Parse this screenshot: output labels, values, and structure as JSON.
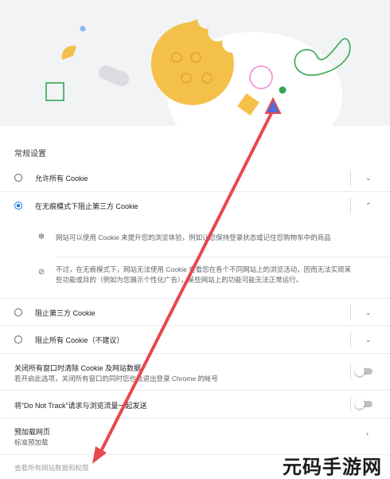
{
  "section_title": "常规设置",
  "options": [
    {
      "label": "允许所有 Cookie",
      "selected": false,
      "expanded": false
    },
    {
      "label": "在无痕模式下阻止第三方 Cookie",
      "selected": true,
      "expanded": true
    },
    {
      "label": "阻止第三方 Cookie",
      "selected": false,
      "expanded": false
    },
    {
      "label": "阻止所有 Cookie（不建议）",
      "selected": false,
      "expanded": false
    }
  ],
  "details": [
    {
      "icon": "cookie-icon",
      "text": "网站可以使用 Cookie 来提升您的浏览体验，例如让您保持登录状态或记住您购物车中的商品"
    },
    {
      "icon": "block-icon",
      "text_line1": "不过，在无痕模式下，网站无法使用 Cookie 查看您在各个不同网站上的浏览活动，因而无法实现某",
      "text_line2": "些功能或目的（例如为您展示个性化广告），某些网站上的功能可能无法正常运行。"
    }
  ],
  "toggles": [
    {
      "title": "关闭所有窗口时清除 Cookie 及网站数据",
      "subtitle": "若开启此选项，关闭所有窗口的同时您也会退出登录 Chrome 的帐号",
      "on": false
    },
    {
      "title": "将“Do Not Track”请求与浏览流量一起发送",
      "on": false
    }
  ],
  "preload": {
    "title": "预加载网页",
    "subtitle": "标准预加载"
  },
  "footer_link": "查看所有网站数据和权限",
  "watermark": "元码手游网",
  "colors": {
    "accent": "#1a73e8",
    "arrow": "#e8474e",
    "cookie": "#f3c04a",
    "header_bg": "#f1f3f4"
  }
}
